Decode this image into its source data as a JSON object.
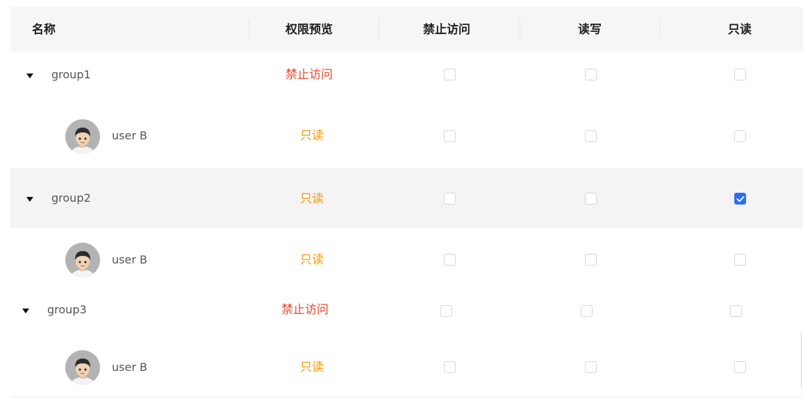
{
  "columns": {
    "name": "名称",
    "preview": "权限预览",
    "deny": "禁止访问",
    "readwrite": "读写",
    "readonly": "只读"
  },
  "rows": [
    {
      "type": "group",
      "label": "group1",
      "preview": "禁止访问",
      "preview_kind": "deny",
      "deny": false,
      "readwrite": false,
      "readonly": false
    },
    {
      "type": "user",
      "label": "user B",
      "preview": "只读",
      "preview_kind": "readonly",
      "deny": false,
      "readwrite": false,
      "readonly": false
    },
    {
      "type": "group",
      "label": "group2",
      "preview": "只读",
      "preview_kind": "readonly",
      "deny": false,
      "readwrite": false,
      "readonly": true
    },
    {
      "type": "user",
      "label": "user B",
      "preview": "只读",
      "preview_kind": "readonly",
      "deny": false,
      "readwrite": false,
      "readonly": false
    },
    {
      "type": "group",
      "label": "group3",
      "preview": "禁止访问",
      "preview_kind": "deny",
      "deny": false,
      "readwrite": false,
      "readonly": false
    },
    {
      "type": "user",
      "label": "user B",
      "preview": "只读",
      "preview_kind": "readonly",
      "deny": false,
      "readwrite": false,
      "readonly": false
    }
  ],
  "colors": {
    "deny": "#e8472b",
    "readonly": "#f39c12",
    "checkbox_checked": "#2f6df6"
  }
}
